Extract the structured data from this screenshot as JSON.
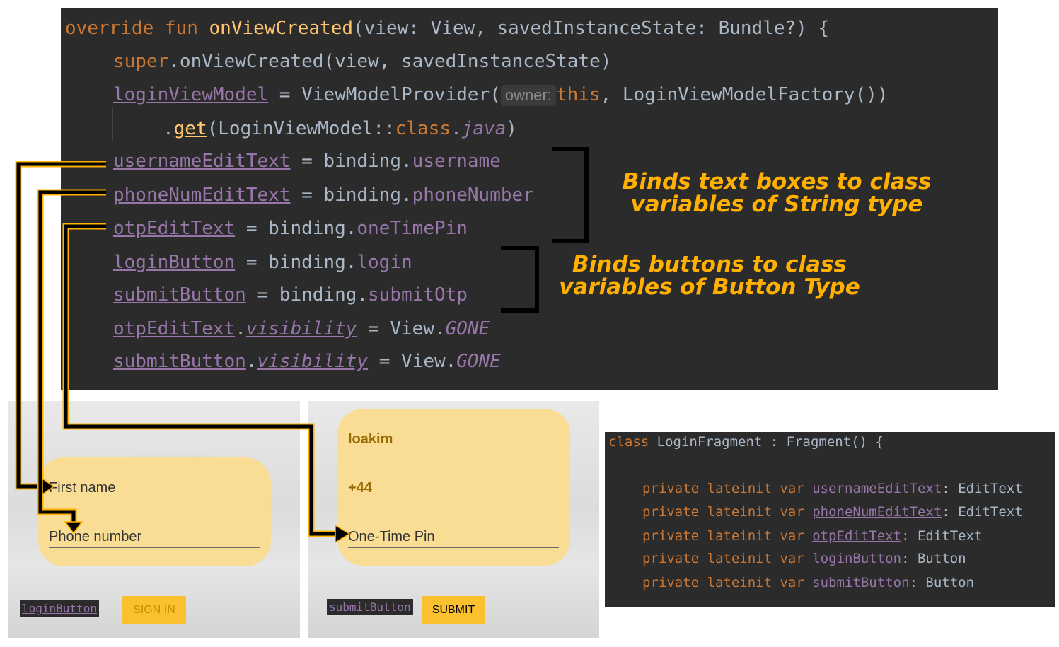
{
  "code": {
    "line1": {
      "kw1": "override",
      "kw2": "fun",
      "fn": "onViewCreated",
      "rest": "(view: View, savedInstanceState: Bundle?) {"
    },
    "line2": {
      "kw": "super",
      "rest": ".onViewCreated(view, savedInstanceState)"
    },
    "line3": {
      "prop": "loginViewModel",
      "mid": " = ViewModelProvider(",
      "hint": "owner:",
      "kw": "this",
      "rest": ", LoginViewModelFactory())"
    },
    "line4": {
      "pre": ".",
      "fn": "get",
      "mid": "(LoginViewModel::",
      "kw": "class",
      "dot": ".",
      "prop": "java",
      "rest": ")"
    },
    "line5": {
      "prop": "usernameEditText",
      "mid": " = binding.",
      "field": "username"
    },
    "line6": {
      "prop": "phoneNumEditText",
      "mid": " = binding.",
      "field": "phoneNumber"
    },
    "line7": {
      "prop": "otpEditText",
      "mid": " = binding.",
      "field": "oneTimePin"
    },
    "line8": {
      "prop": "loginButton",
      "mid": " = binding.",
      "field": "login"
    },
    "line9": {
      "prop": "submitButton",
      "mid": " = binding.",
      "field": "submitOtp"
    },
    "line10": {
      "prop": "otpEditText",
      "dot": ".",
      "prop2": "visibility",
      "mid": " = View.",
      "const": "GONE"
    },
    "line11": {
      "prop": "submitButton",
      "dot": ".",
      "prop2": "visibility",
      "mid": " = View.",
      "const": "GONE"
    }
  },
  "annotations": {
    "text_boxes": {
      "line1": "Binds text boxes to class",
      "line2": "variables of String type"
    },
    "buttons": {
      "line1": "Binds buttons to class",
      "line2": "variables of Button Type"
    }
  },
  "login_screen": {
    "first_name_placeholder": "First name",
    "phone_placeholder": "Phone number",
    "tag": "loginButton",
    "button": "SIGN IN"
  },
  "otp_screen": {
    "name_value": "Ioakim",
    "phone_value": "+44",
    "otp_placeholder": "One-Time Pin",
    "tag": "submitButton",
    "button": "SUBMIT"
  },
  "declarations": {
    "class_line": {
      "kw": "class",
      "rest": " LoginFragment : Fragment() {"
    },
    "vars": [
      {
        "kw": "private lateinit var",
        "name": "usernameEditText",
        "type": ": EditText"
      },
      {
        "kw": "private lateinit var",
        "name": "phoneNumEditText",
        "type": ": EditText"
      },
      {
        "kw": "private lateinit var",
        "name": "otpEditText",
        "type": ": EditText"
      },
      {
        "kw": "private lateinit var",
        "name": "loginButton",
        "type": ": Button"
      },
      {
        "kw": "private lateinit var",
        "name": "submitButton",
        "type": ": Button"
      }
    ]
  },
  "colors": {
    "keyword": "#cc7832",
    "function": "#ffc66d",
    "property": "#9876aa",
    "text": "#a9b7c6",
    "editor_bg": "#2b2b2b",
    "annotation": "#ffb000",
    "card": "#f9dd95",
    "button": "#fbc02d"
  }
}
